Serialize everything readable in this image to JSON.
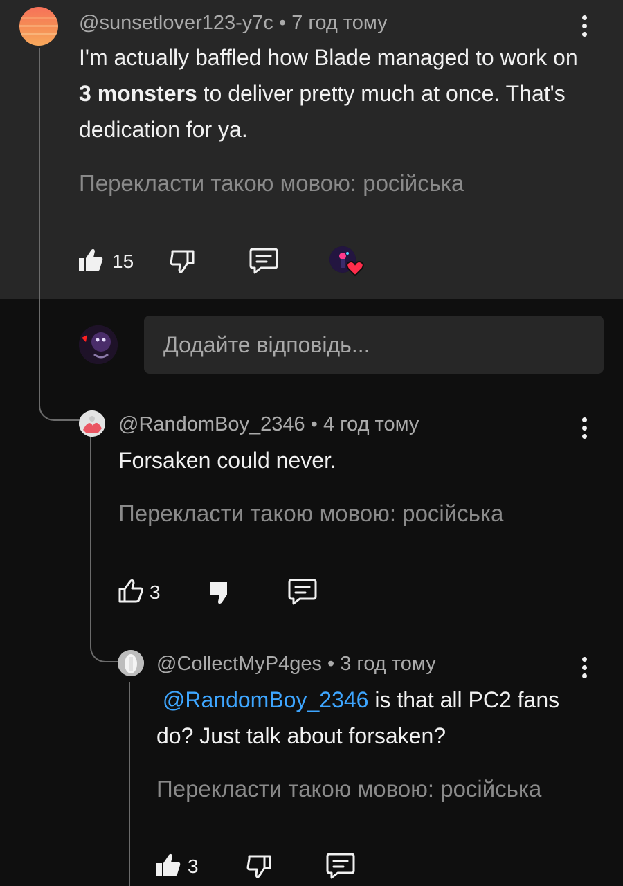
{
  "comment": {
    "author": "@sunsetlover123-y7c",
    "time": "7 год тому",
    "text_parts": [
      "I'm actually baffled how Blade managed to work on ",
      "3 monsters",
      " to deliver pretty much at once. That's dedication for ya."
    ],
    "translate": "Перекласти такою мовою: російська",
    "likes": "15"
  },
  "reply_input": {
    "placeholder": "Додайте відповідь..."
  },
  "replies": [
    {
      "author": "@RandomBoy_2346",
      "time": "4 год тому",
      "text": "Forsaken could never.",
      "translate": "Перекласти такою мовою: російська",
      "likes": "3"
    },
    {
      "author": "@CollectMyP4ges",
      "time": "3 год тому",
      "mention": "@RandomBoy_2346",
      "text": " is that all PC2 fans do? Just talk about forsaken?",
      "translate": "Перекласти такою мовою: російська",
      "likes": "3"
    }
  ],
  "separator": " • ",
  "colors": {
    "mention": "#3ea6ff",
    "heart": "#ff2d4b",
    "panel": "#272727",
    "background": "#0f0f0f"
  },
  "icons": [
    "like-icon",
    "dislike-icon",
    "reply-icon",
    "creator-heart-icon",
    "more-vert-icon"
  ]
}
